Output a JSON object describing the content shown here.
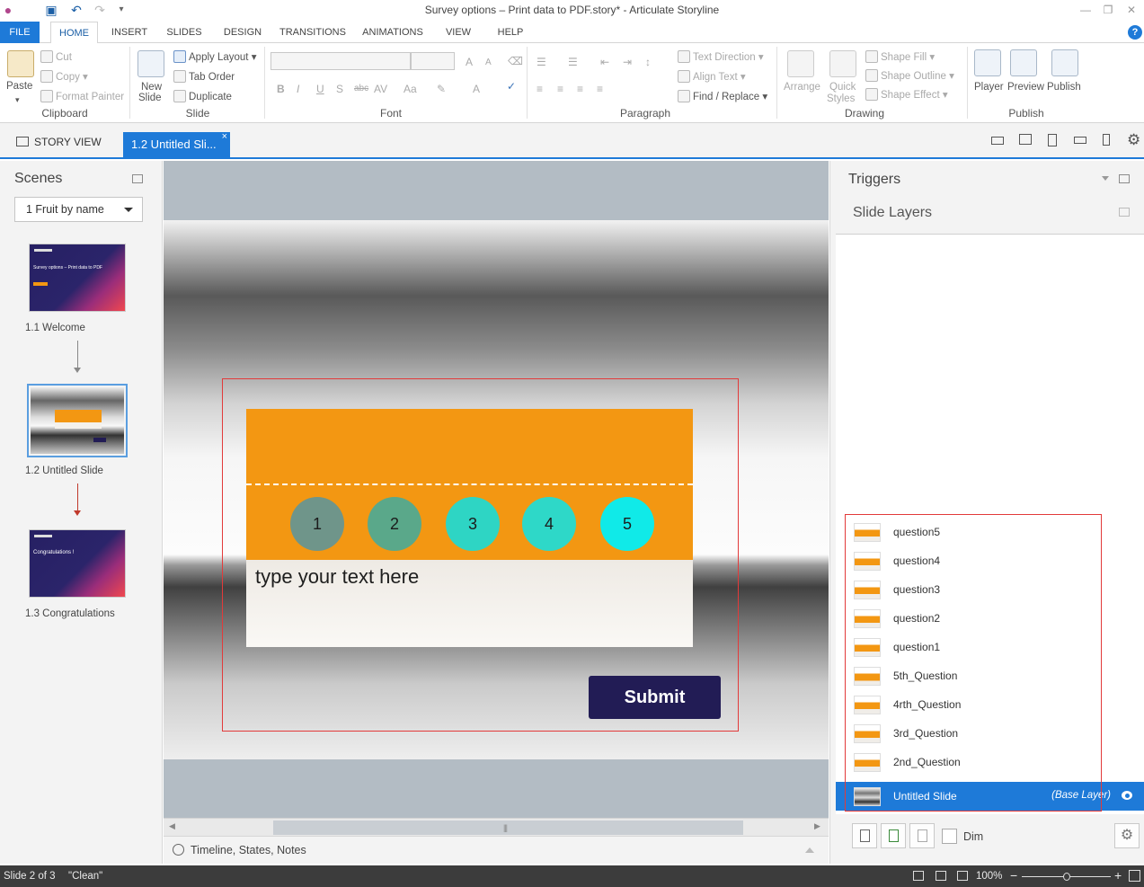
{
  "window": {
    "title": "Survey options – Print data to PDF.story* - Articulate Storyline",
    "icons": [
      "app-icon",
      "save-icon",
      "undo-icon",
      "redo-icon",
      "customize-icon"
    ],
    "minimize_label": "—",
    "maximize_label": "❐",
    "close_label": "✕"
  },
  "ribbon_tabs": [
    "FILE",
    "HOME",
    "INSERT",
    "SLIDES",
    "DESIGN",
    "TRANSITIONS",
    "ANIMATIONS",
    "VIEW",
    "HELP"
  ],
  "ribbon_active_tab": "HOME",
  "help_label": "?",
  "ribbon": {
    "clipboard": {
      "paste": "Paste",
      "cut": "Cut",
      "copy": "Copy",
      "format_painter": "Format Painter",
      "label": "Clipboard"
    },
    "slide": {
      "new_slide_line1": "New",
      "new_slide_line2": "Slide",
      "apply_layout": "Apply Layout",
      "tab_order": "Tab Order",
      "duplicate": "Duplicate",
      "label": "Slide"
    },
    "font": {
      "label": "Font",
      "glyphs": [
        "B",
        "I",
        "U",
        "S",
        "abc",
        "AV",
        "Aa",
        "A"
      ]
    },
    "paragraph": {
      "text_direction": "Text Direction",
      "align_text": "Align Text",
      "find_replace": "Find / Replace",
      "label": "Paragraph"
    },
    "drawing": {
      "arrange": "Arrange",
      "quick_styles_line1": "Quick",
      "quick_styles_line2": "Styles",
      "shape_fill": "Shape Fill",
      "shape_outline": "Shape Outline",
      "shape_effect": "Shape Effect",
      "label": "Drawing"
    },
    "publish": {
      "player": "Player",
      "preview": "Preview",
      "publish": "Publish",
      "label": "Publish"
    }
  },
  "tabstrip": {
    "story_view": "STORY VIEW",
    "slide_tab": "1.2 Untitled Sli...",
    "close_label": "×"
  },
  "scenes": {
    "title": "Scenes",
    "selected_scene": "1 Fruit by name",
    "slides": [
      {
        "label": "1.1 Welcome",
        "thumb_title": "Survey options – Print data to PDF"
      },
      {
        "label": "1.2 Untitled Slide"
      },
      {
        "label": "1.3 Congratulations",
        "thumb_title": "Congratulations !"
      }
    ]
  },
  "canvas": {
    "circles": [
      {
        "label": "1",
        "color": "#6f958a"
      },
      {
        "label": "2",
        "color": "#5aa88a"
      },
      {
        "label": "3",
        "color": "#2ed5c4"
      },
      {
        "label": "4",
        "color": "#2ed8c8"
      },
      {
        "label": "5",
        "color": "#10eae8"
      }
    ],
    "placeholder_text": "type your text here",
    "submit_label": "Submit",
    "accent_orange": "#f39712",
    "submit_color": "#221c55"
  },
  "timeline_bar": {
    "label": "Timeline, States, Notes"
  },
  "right_panel": {
    "triggers_title": "Triggers",
    "layers_title": "Slide Layers",
    "layers": [
      "question5",
      "question4",
      "question3",
      "question2",
      "question1",
      "5th_Question",
      "4rth_Question",
      "3rd_Question",
      "2nd_Question"
    ],
    "base_layer": {
      "name": "Untitled Slide",
      "tag": "(Base Layer)"
    },
    "dim_label": "Dim"
  },
  "statusbar": {
    "slide_pos": "Slide 2 of 3",
    "theme": "\"Clean\"",
    "zoom": "100%",
    "minus": "−",
    "plus": "+"
  }
}
